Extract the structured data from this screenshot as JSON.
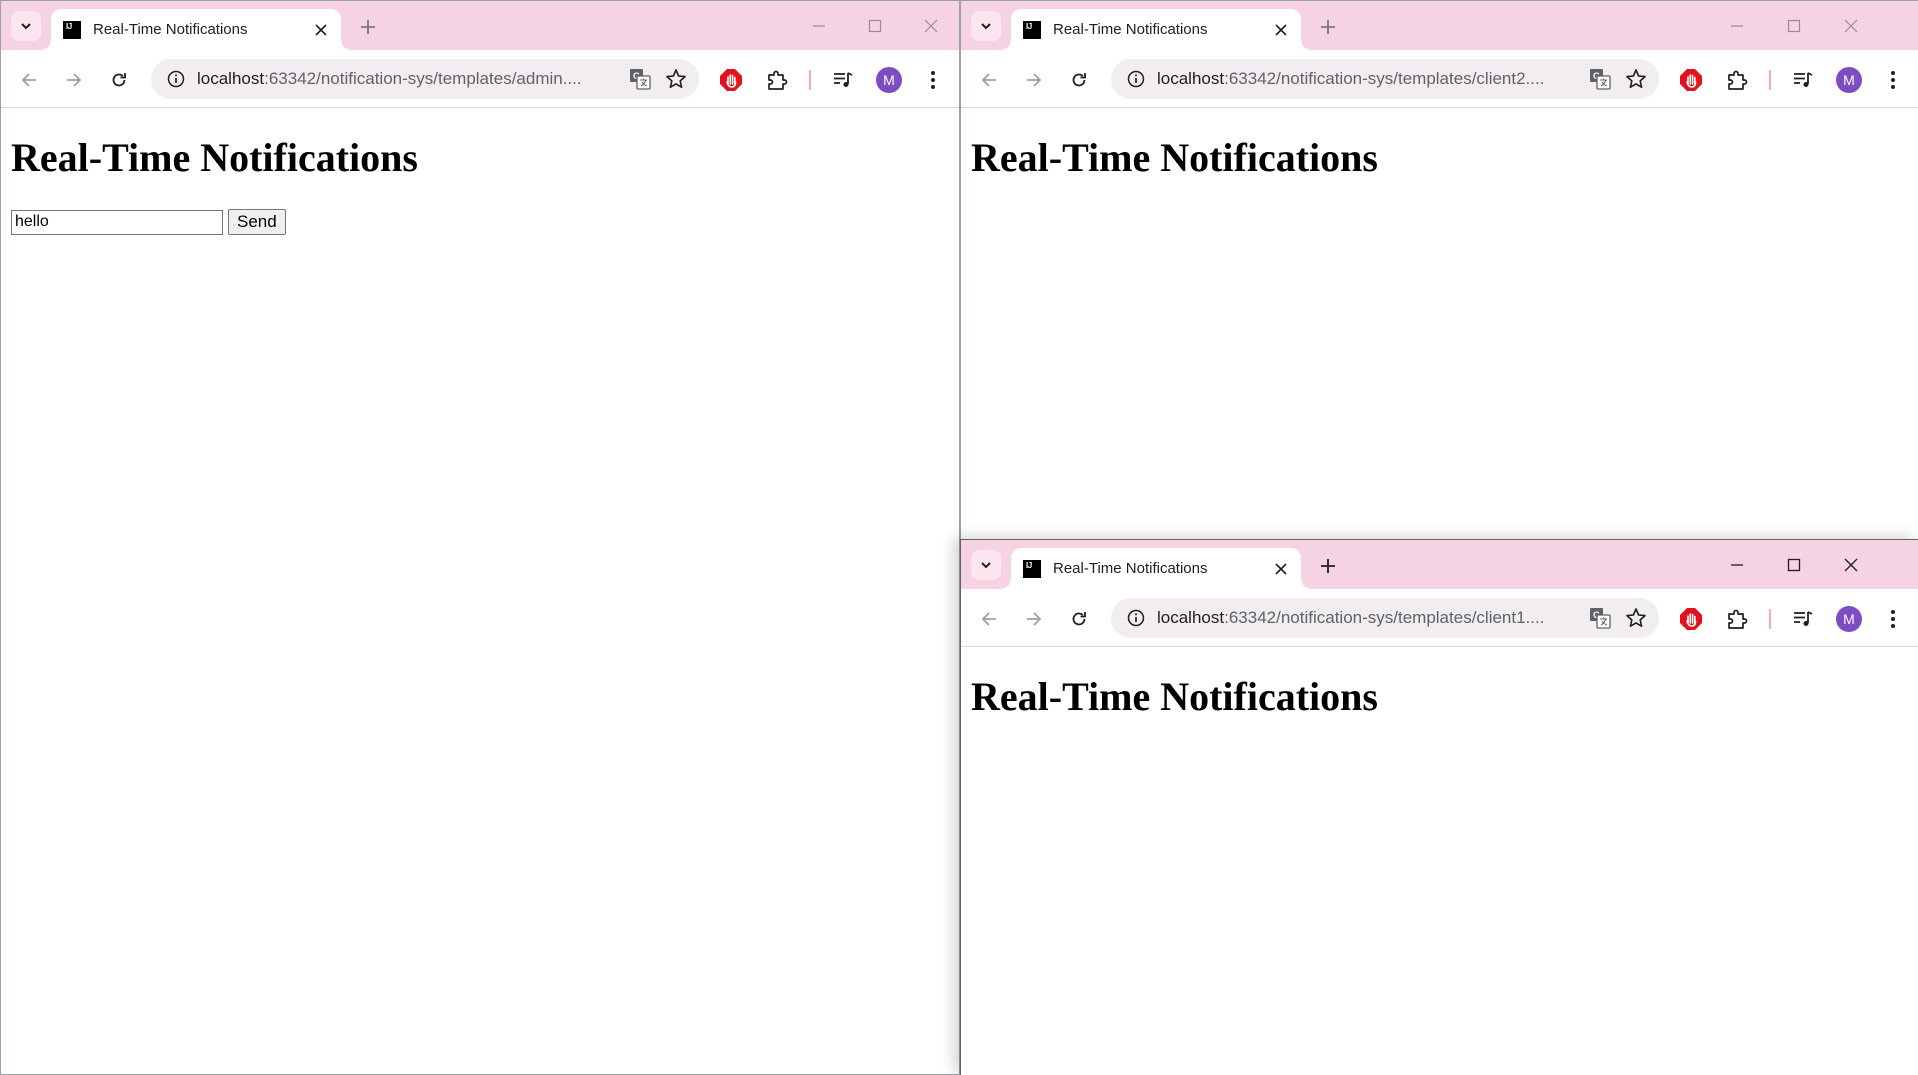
{
  "windows": {
    "admin": {
      "tab_title": "Real-Time Notifications",
      "url_host": "localhost",
      "url_rest": ":63342/notification-sys/templates/admin....",
      "heading": "Real-Time Notifications",
      "input_value": "hello",
      "send_label": "Send",
      "avatar_letter": "M"
    },
    "client2": {
      "tab_title": "Real-Time Notifications",
      "url_host": "localhost",
      "url_rest": ":63342/notification-sys/templates/client2....",
      "heading": "Real-Time Notifications",
      "avatar_letter": "M"
    },
    "client1": {
      "tab_title": "Real-Time Notifications",
      "url_host": "localhost",
      "url_rest": ":63342/notification-sys/templates/client1....",
      "heading": "Real-Time Notifications",
      "avatar_letter": "M"
    }
  },
  "colors": {
    "titlebar": "#f5d3e3",
    "omnibox": "#f1edf0",
    "avatar": "#7b4cc2",
    "adblock": "#e0141e"
  },
  "icons": [
    "tab-search-icon",
    "close-icon",
    "plus-icon",
    "minimize-icon",
    "maximize-icon",
    "back-icon",
    "forward-icon",
    "reload-icon",
    "info-icon",
    "translate-icon",
    "star-icon",
    "adblock-icon",
    "extensions-icon",
    "media-icon",
    "menu-icon"
  ]
}
